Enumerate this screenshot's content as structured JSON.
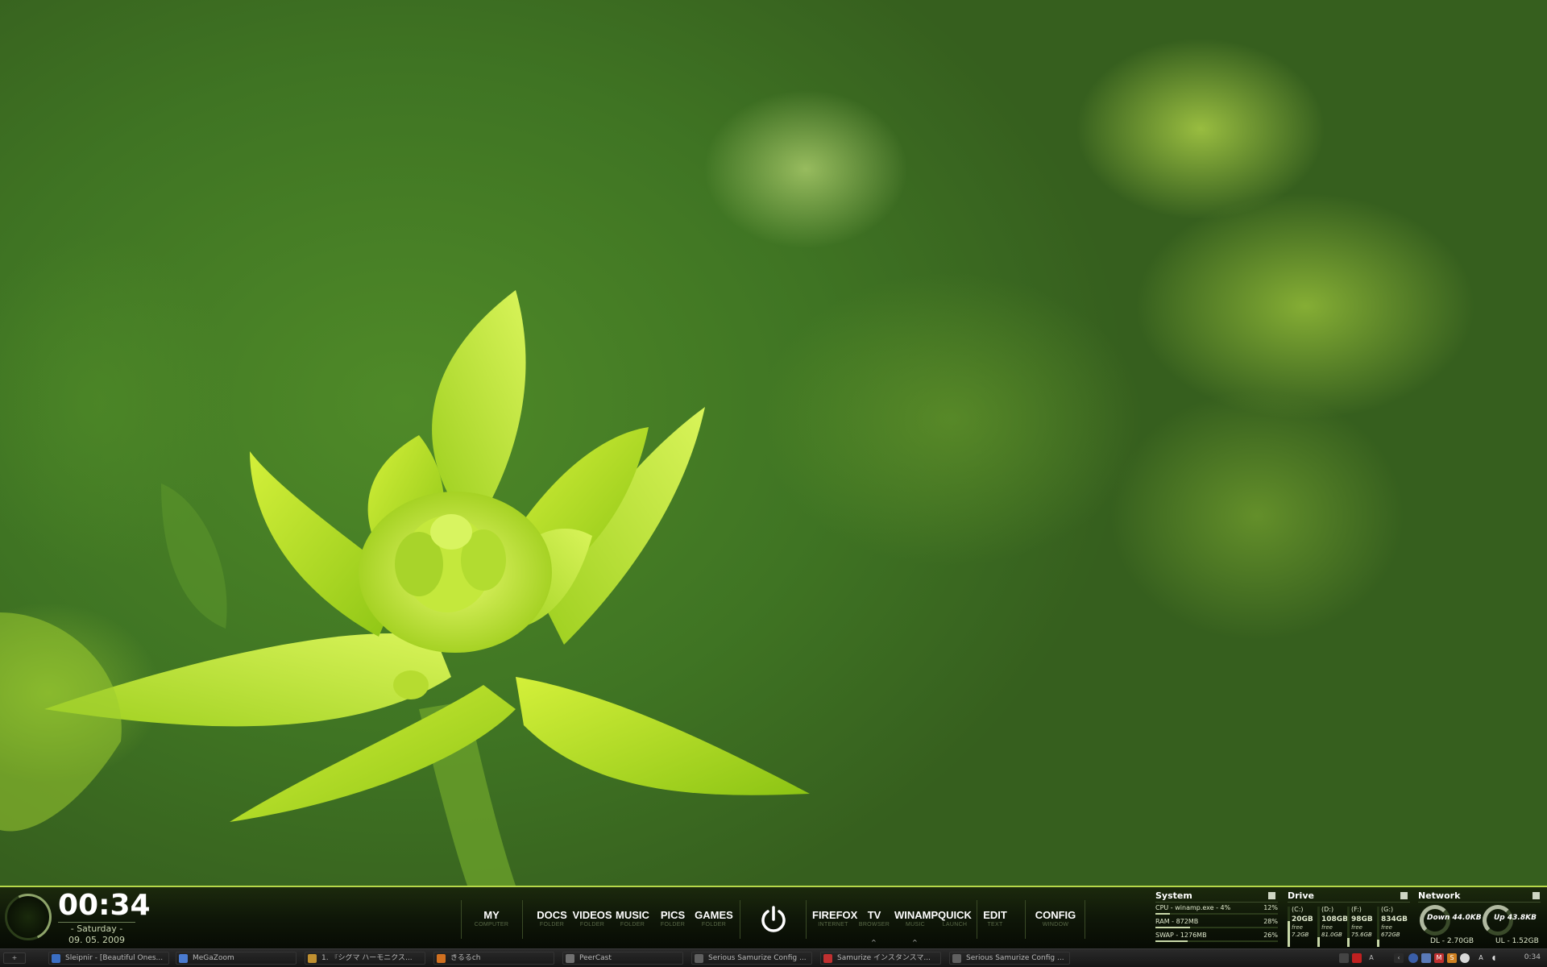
{
  "clock": {
    "time": "00:34",
    "day": "- Saturday -",
    "date": "09. 05. 2009"
  },
  "launcher": {
    "items": [
      {
        "main": "MY",
        "sub": "COMPUTER"
      },
      {
        "main": "DOCS",
        "sub": "FOLDER"
      },
      {
        "main": "VIDEOS",
        "sub": "FOLDER"
      },
      {
        "main": "MUSIC",
        "sub": "FOLDER"
      },
      {
        "main": "PICS",
        "sub": "FOLDER"
      },
      {
        "main": "GAMES",
        "sub": "FOLDER"
      },
      {
        "main": "FIREFOX",
        "sub": "INTERNET"
      },
      {
        "main": "TV",
        "sub": "BROWSER"
      },
      {
        "main": "WINAMP",
        "sub": "MUSIC"
      },
      {
        "main": "QUICK",
        "sub": "LAUNCH"
      },
      {
        "main": "EDIT",
        "sub": "TEXT"
      },
      {
        "main": "CONFIG",
        "sub": "WINDOW"
      }
    ],
    "power_icon": "power-icon"
  },
  "system": {
    "title": "System",
    "rows": [
      {
        "label": "CPU -  winamp.exe - 4%",
        "pct": "12%",
        "fraction": 0.12
      },
      {
        "label": "RAM - 872MB",
        "pct": "28%",
        "fraction": 0.28
      },
      {
        "label": "SWAP - 1276MB",
        "pct": "26%",
        "fraction": 0.26
      }
    ]
  },
  "drive": {
    "title": "Drive",
    "drives": [
      {
        "letter": "(C:)",
        "total": "20GB",
        "free_label": "free",
        "free": "7.2GB",
        "used_fraction": 0.64
      },
      {
        "letter": "(D:)",
        "total": "108GB",
        "free_label": "free",
        "free": "81.0GB",
        "used_fraction": 0.25
      },
      {
        "letter": "(F:)",
        "total": "98GB",
        "free_label": "free",
        "free": "75.6GB",
        "used_fraction": 0.23
      },
      {
        "letter": "(G:)",
        "total": "834GB",
        "free_label": "free",
        "free": "672GB",
        "used_fraction": 0.19
      }
    ]
  },
  "network": {
    "title": "Network",
    "down_rate": "Down 44.0KB",
    "up_rate": "Up 43.8KB",
    "dl_total": "DL - 2.70GB",
    "ul_total": "UL - 1.52GB"
  },
  "taskbar": {
    "start_label": "+",
    "tasks": [
      {
        "label": "Sleipnir - [Beautiful Ones...",
        "icon": "browser-icon",
        "color": "#3b6fc4"
      },
      {
        "label": "MeGaZoom",
        "icon": "zoom-icon",
        "color": "#4a7bd0"
      },
      {
        "label": "1. 『シグマ ハーモニクス...",
        "icon": "media-icon",
        "color": "#c09030"
      },
      {
        "label": "きるるch",
        "icon": "chat-icon",
        "color": "#d07020"
      },
      {
        "label": "PeerCast",
        "icon": "peercast-icon",
        "color": "#707070"
      },
      {
        "label": "Serious Samurize Config ...",
        "icon": "samurize-icon",
        "color": "#606060"
      },
      {
        "label": "Samurize インスタンスマ...",
        "icon": "samurize-instance-icon",
        "color": "#c03030"
      },
      {
        "label": "Serious Samurize Config ...",
        "icon": "samurize-icon",
        "color": "#606060"
      }
    ],
    "tray_time": "0:34"
  }
}
